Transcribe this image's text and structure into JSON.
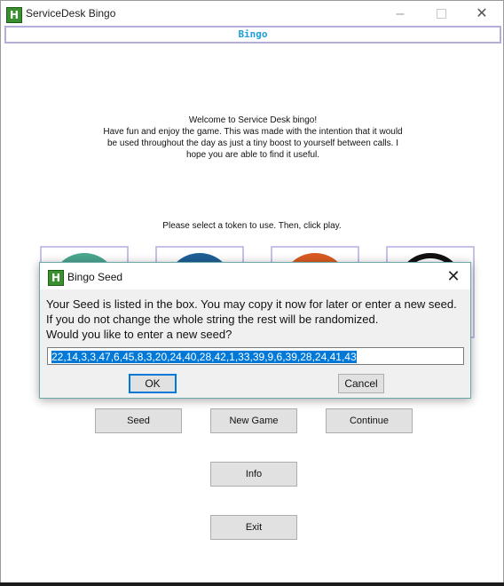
{
  "window": {
    "title": "ServiceDesk Bingo",
    "app_icon": "H"
  },
  "header": {
    "bingo_label": "Bingo"
  },
  "welcome_text": "Welcome to Service Desk bingo!\nHave fun and enjoy the game. This was made with the intention that it would\nbe used throughout the day as just a tiny boost to yourself between calls. I\nhope you are able to find it useful.",
  "instruction_text": "Please select a token to use. Then, click play.",
  "tokens": [
    {
      "name": "teal-token",
      "color": "#4aa58f"
    },
    {
      "name": "blue-token",
      "color": "#1f5f97"
    },
    {
      "name": "orange-token",
      "color": "#d95b21"
    },
    {
      "name": "black-ring-token",
      "color": "#111111"
    }
  ],
  "buttons": {
    "seed": "Seed",
    "new_game": "New Game",
    "continue": "Continue",
    "info": "Info",
    "exit": "Exit"
  },
  "dialog": {
    "title": "Bingo Seed",
    "app_icon": "H",
    "message_lines": [
      "Your Seed is listed in the box. You may copy it now for later or enter a new seed.",
      "If you do not change the whole string the rest will be randomized.",
      "Would you like to enter a new seed?"
    ],
    "seed_value": "22,14,3,3,47,6,45,8,3,20,24,40,28,42,1,33,39,9,6,39,28,24,41,43",
    "ok_label": "OK",
    "cancel_label": "Cancel"
  }
}
